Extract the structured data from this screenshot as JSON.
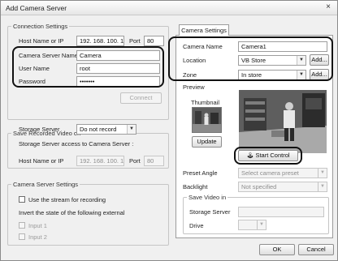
{
  "window": {
    "title": "Add Camera Server",
    "close_glyph": "×"
  },
  "connection": {
    "legend": "Connection Settings",
    "host_label": "Host Name or IP",
    "host_value": "192. 168. 100. 1",
    "port_label": "Port",
    "port_value": "80",
    "server_name_label": "Camera Server Name",
    "server_name_value": "Camera",
    "user_label": "User Name",
    "user_value": "root",
    "password_label": "Password",
    "password_value": "•••••••",
    "connect_label": "Connect"
  },
  "save_recorded": {
    "legend": "Save Recorded Video on",
    "storage_label": "Storage Server",
    "storage_value": "Do not record",
    "access_label": "Storage Server access to Camera Server :",
    "host_label": "Host Name or IP",
    "host_value": "192. 168. 100. 1",
    "port_label": "Port",
    "port_value": "80"
  },
  "server_settings": {
    "legend": "Camera Server Settings",
    "use_stream_label": "Use the stream for recording",
    "invert_label": "Invert the state of the following external",
    "input1_label": "Input 1",
    "input2_label": "Input 2"
  },
  "camera_settings": {
    "tab_label": "Camera Settings",
    "name_label": "Camera Name",
    "name_value": "Camera1",
    "location_label": "Location",
    "location_value": "VB Store",
    "zone_label": "Zone",
    "zone_value": "In store",
    "add_label": "Add...",
    "preview_label": "Preview",
    "thumbnail_label": "Thumbnail",
    "update_label": "Update",
    "start_control_label": "Start Control",
    "preset_label": "Preset Angle",
    "preset_placeholder": "Select camera preset",
    "backlight_label": "Backlight",
    "backlight_value": "Not specified",
    "save_video_legend": "Save Video in",
    "storage_label": "Storage Server",
    "drive_label": "Drive"
  },
  "footer": {
    "ok_label": "OK",
    "cancel_label": "Cancel"
  },
  "colors": {
    "highlight": "#111111",
    "accent_border": "#9c9c9c"
  },
  "icons": {
    "close": "close-icon",
    "dropdown": "chevron-down-icon",
    "control": "joystick-icon"
  }
}
